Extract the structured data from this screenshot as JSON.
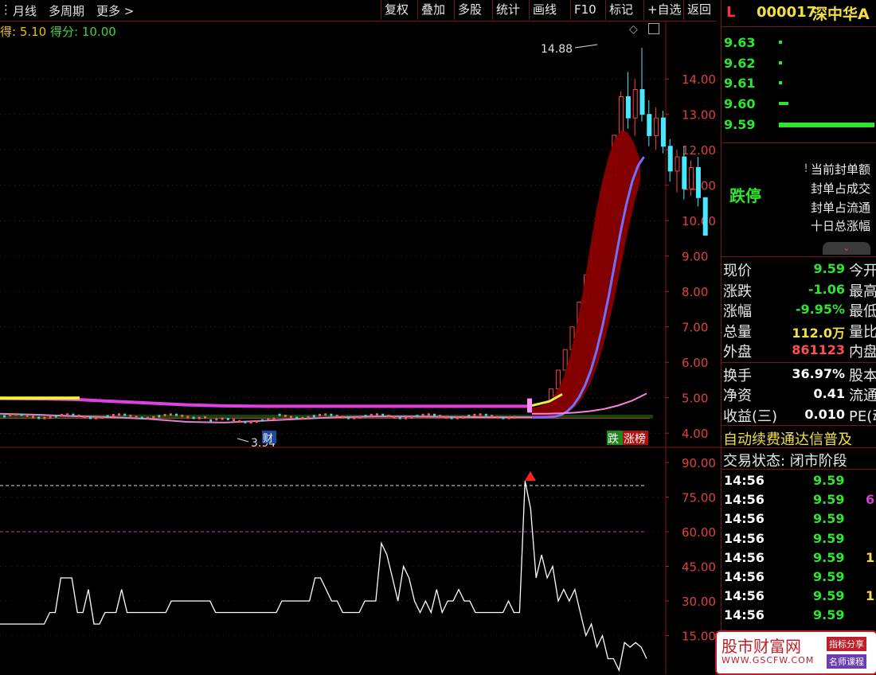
{
  "toolbar": {
    "left_items": [
      "月线",
      "多周期",
      "更多 >"
    ],
    "right_items": [
      "复权",
      "叠加",
      "多股",
      "统计",
      "画线",
      "F10",
      "标记",
      "+自选",
      "返回"
    ]
  },
  "indicator": {
    "label_prefix": "得: 5.10",
    "score_label": "得分: 10.00"
  },
  "chart_data": [
    {
      "type": "candlestick",
      "title": "",
      "y_ticks": [
        "14.00",
        "13.00",
        "12.00",
        "11.00",
        "10.00",
        "9.00",
        "8.00",
        "7.00",
        "6.00",
        "5.00",
        "4.00"
      ],
      "ylim": [
        3.6,
        15.4
      ],
      "annotations": {
        "high": "14.88",
        "low": "3.94",
        "fin_badge": "财",
        "tag1": "跌",
        "tag2": "涨榜"
      },
      "candles": [
        {
          "o": 4.62,
          "h": 4.68,
          "l": 4.58,
          "c": 4.65
        },
        {
          "o": 4.65,
          "h": 4.7,
          "l": 4.6,
          "c": 4.62
        },
        {
          "o": 4.62,
          "h": 4.66,
          "l": 4.56,
          "c": 4.6
        },
        {
          "o": 4.6,
          "h": 4.64,
          "l": 4.52,
          "c": 4.55
        },
        {
          "o": 4.55,
          "h": 4.6,
          "l": 4.48,
          "c": 4.5
        },
        {
          "o": 4.5,
          "h": 4.55,
          "l": 4.42,
          "c": 4.45
        },
        {
          "o": 4.45,
          "h": 4.48,
          "l": 4.3,
          "c": 4.35
        },
        {
          "o": 4.35,
          "h": 4.4,
          "l": 4.1,
          "c": 4.15
        },
        {
          "o": 4.15,
          "h": 4.2,
          "l": 3.94,
          "c": 4.05
        },
        {
          "o": 4.05,
          "h": 4.25,
          "l": 4.02,
          "c": 4.22
        },
        {
          "o": 4.22,
          "h": 4.4,
          "l": 4.18,
          "c": 4.36
        },
        {
          "o": 4.36,
          "h": 4.45,
          "l": 4.3,
          "c": 4.42
        },
        {
          "o": 4.42,
          "h": 4.48,
          "l": 4.35,
          "c": 4.4
        },
        {
          "o": 4.4,
          "h": 4.46,
          "l": 4.36,
          "c": 4.44
        },
        {
          "o": 4.44,
          "h": 4.5,
          "l": 4.38,
          "c": 4.41
        },
        {
          "o": 4.41,
          "h": 4.46,
          "l": 4.35,
          "c": 4.38
        },
        {
          "o": 4.38,
          "h": 4.43,
          "l": 4.3,
          "c": 4.33
        },
        {
          "o": 4.33,
          "h": 4.4,
          "l": 4.28,
          "c": 4.37
        },
        {
          "o": 4.37,
          "h": 4.45,
          "l": 4.34,
          "c": 4.42
        },
        {
          "o": 4.42,
          "h": 4.5,
          "l": 4.38,
          "c": 4.47
        },
        {
          "o": 4.47,
          "h": 4.6,
          "l": 4.44,
          "c": 4.56
        },
        {
          "o": 4.56,
          "h": 4.8,
          "l": 4.52,
          "c": 4.78
        },
        {
          "o": 4.78,
          "h": 5.25,
          "l": 4.78,
          "c": 5.25
        },
        {
          "o": 5.25,
          "h": 5.78,
          "l": 5.25,
          "c": 5.78
        },
        {
          "o": 5.78,
          "h": 6.36,
          "l": 5.78,
          "c": 6.36
        },
        {
          "o": 6.36,
          "h": 7.0,
          "l": 6.36,
          "c": 7.0
        },
        {
          "o": 7.0,
          "h": 7.7,
          "l": 7.0,
          "c": 7.7
        },
        {
          "o": 7.7,
          "h": 8.47,
          "l": 7.7,
          "c": 8.47
        },
        {
          "o": 8.47,
          "h": 9.32,
          "l": 8.47,
          "c": 9.32
        },
        {
          "o": 9.32,
          "h": 10.25,
          "l": 9.32,
          "c": 10.25
        },
        {
          "o": 10.25,
          "h": 11.28,
          "l": 10.25,
          "c": 11.28
        },
        {
          "o": 11.28,
          "h": 12.41,
          "l": 11.28,
          "c": 12.41
        },
        {
          "o": 12.41,
          "h": 13.65,
          "l": 12.2,
          "c": 13.5
        },
        {
          "o": 13.5,
          "h": 14.2,
          "l": 12.6,
          "c": 12.9
        },
        {
          "o": 12.9,
          "h": 14.0,
          "l": 12.4,
          "c": 13.7
        },
        {
          "o": 13.7,
          "h": 14.88,
          "l": 12.8,
          "c": 13.0
        },
        {
          "o": 13.0,
          "h": 13.4,
          "l": 12.1,
          "c": 12.4
        },
        {
          "o": 12.4,
          "h": 13.2,
          "l": 12.0,
          "c": 12.9
        },
        {
          "o": 12.9,
          "h": 13.1,
          "l": 11.9,
          "c": 12.1
        },
        {
          "o": 12.1,
          "h": 12.3,
          "l": 11.1,
          "c": 11.4
        },
        {
          "o": 11.4,
          "h": 12.0,
          "l": 10.8,
          "c": 11.8
        },
        {
          "o": 11.8,
          "h": 12.1,
          "l": 10.6,
          "c": 10.9
        },
        {
          "o": 10.9,
          "h": 11.7,
          "l": 10.7,
          "c": 11.5
        },
        {
          "o": 11.5,
          "h": 11.8,
          "l": 10.4,
          "c": 10.65
        },
        {
          "o": 10.65,
          "h": 10.65,
          "l": 9.59,
          "c": 9.59
        }
      ],
      "ma_white": [
        4.45,
        4.45,
        4.45,
        4.46,
        4.47,
        4.52,
        4.62,
        4.78,
        5.02,
        5.35,
        5.78,
        6.35,
        7.05,
        7.85,
        8.75,
        9.65,
        10.45,
        11.1,
        11.55,
        11.8
      ],
      "ma_red": [
        4.72,
        4.75,
        4.82,
        4.95,
        5.2,
        5.6,
        6.2,
        7.0,
        8.0,
        9.1,
        10.2,
        11.1,
        11.8,
        12.3,
        12.55,
        12.5,
        12.2,
        11.7
      ],
      "ma_long": [
        4.55,
        4.55,
        4.56,
        4.58,
        4.62,
        4.68,
        4.78,
        4.92,
        5.12
      ],
      "band_upper": [
        4.98,
        4.97,
        4.95,
        4.9,
        4.85,
        4.8,
        4.77,
        4.76,
        4.76,
        4.76,
        4.76,
        4.76,
        4.76,
        4.76,
        4.76
      ],
      "band_lower": [
        4.55,
        4.52,
        4.48,
        4.45,
        4.4,
        4.32,
        4.3,
        4.35,
        4.4,
        4.45,
        4.47,
        4.47,
        4.46,
        4.45,
        4.45
      ]
    },
    {
      "type": "line",
      "title": "",
      "y_ticks": [
        "90.00",
        "75.00",
        "60.00",
        "45.00",
        "30.00",
        "15.00"
      ],
      "ylim": [
        0,
        98
      ],
      "ref_lines": [
        80,
        60
      ],
      "values": [
        20,
        20,
        20,
        20,
        20,
        20,
        20,
        20,
        20,
        25,
        25,
        40,
        40,
        40,
        25,
        25,
        35,
        20,
        20,
        25,
        25,
        25,
        35,
        25,
        25,
        25,
        25,
        25,
        25,
        25,
        25,
        30,
        30,
        30,
        30,
        30,
        30,
        30,
        30,
        25,
        25,
        25,
        25,
        25,
        25,
        25,
        25,
        25,
        25,
        25,
        25,
        30,
        30,
        30,
        30,
        30,
        30,
        40,
        40,
        35,
        30,
        30,
        25,
        25,
        25,
        25,
        30,
        30,
        30,
        55,
        50,
        40,
        30,
        45,
        40,
        30,
        25,
        30,
        25,
        35,
        25,
        30,
        30,
        35,
        30,
        30,
        25,
        25,
        25,
        25,
        25,
        25,
        30,
        25,
        25,
        82,
        70,
        40,
        50,
        40,
        45,
        30,
        35,
        30,
        35,
        25,
        15,
        20,
        10,
        15,
        5,
        5,
        0,
        12,
        10,
        12,
        10,
        5
      ]
    }
  ],
  "quote_header": {
    "market_flag": "L",
    "code": "000017",
    "name": "深中华A"
  },
  "bid_ladder": {
    "prices": [
      "9.63",
      "9.62",
      "9.61",
      "9.60",
      "9.59"
    ],
    "vols": [
      1,
      1,
      1,
      12,
      120
    ]
  },
  "limit_box": {
    "status": "跌停",
    "lines": [
      "当前封单额",
      "封单占成交",
      "封单占流通",
      "十日总涨幅"
    ]
  },
  "stats": [
    {
      "label": "现价",
      "value": "9.59",
      "label2": "今开",
      "vclass": "vg"
    },
    {
      "label": "涨跌",
      "value": "-1.06",
      "label2": "最高",
      "vclass": "vg"
    },
    {
      "label": "涨幅",
      "value": "-9.95%",
      "label2": "最低",
      "vclass": "vg"
    },
    {
      "label": "总量",
      "value": "112.0万",
      "label2": "量比",
      "vclass": "vy"
    },
    {
      "label": "外盘",
      "value": "861123",
      "label2": "内盘",
      "vclass": "vr"
    },
    {
      "label": "换手",
      "value": "36.97%",
      "label2": "股本",
      "vclass": "vw"
    },
    {
      "label": "净资",
      "value": "0.41",
      "label2": "流通",
      "vclass": "vw"
    },
    {
      "label": "收益(三)",
      "value": "0.010",
      "label2": "PE(动)",
      "vclass": "vw"
    }
  ],
  "banner": "自动续费通达信普及",
  "trade_status": "交易状态: 闭市阶段",
  "ticks": [
    {
      "time": "14:56",
      "price": "9.59",
      "vol": "",
      "vc": "#f0e040"
    },
    {
      "time": "14:56",
      "price": "9.59",
      "vol": "6",
      "vc": "#d040d0"
    },
    {
      "time": "14:56",
      "price": "9.59",
      "vol": "",
      "vc": "#fff"
    },
    {
      "time": "14:56",
      "price": "9.59",
      "vol": "",
      "vc": "#fff"
    },
    {
      "time": "14:56",
      "price": "9.59",
      "vol": "1",
      "vc": "#f0e040"
    },
    {
      "time": "14:56",
      "price": "9.59",
      "vol": "",
      "vc": "#fff"
    },
    {
      "time": "14:56",
      "price": "9.59",
      "vol": "1",
      "vc": "#f0e040"
    },
    {
      "time": "14:56",
      "price": "9.59",
      "vol": "",
      "vc": "#fff"
    }
  ],
  "watermark": {
    "title": "股市财富网",
    "url": "WWW.GSCFW.COM",
    "tag1": "指标分享",
    "tag2": "名师课程"
  }
}
